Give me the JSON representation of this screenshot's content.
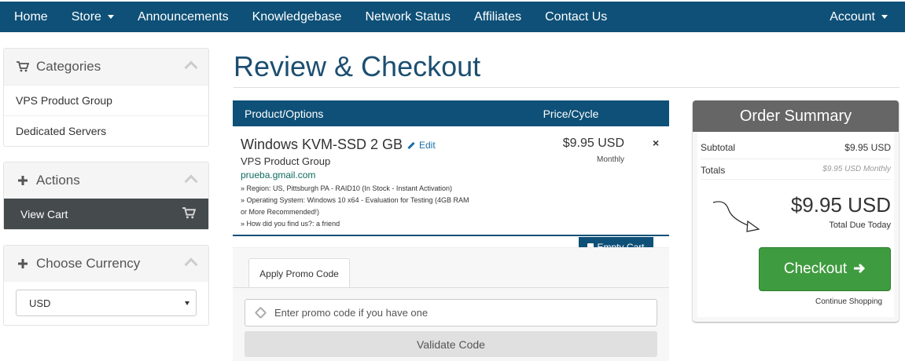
{
  "nav": {
    "home": "Home",
    "store": "Store",
    "announcements": "Announcements",
    "knowledgebase": "Knowledgebase",
    "network_status": "Network Status",
    "affiliates": "Affiliates",
    "contact_us": "Contact Us",
    "account": "Account"
  },
  "sidebar": {
    "categories": {
      "title": "Categories",
      "items": [
        "VPS Product Group",
        "Dedicated Servers"
      ]
    },
    "actions": {
      "title": "Actions",
      "items": [
        "View Cart"
      ]
    },
    "currency": {
      "title": "Choose Currency",
      "selected": "USD"
    }
  },
  "main": {
    "title": "Review & Checkout",
    "table_headers": {
      "product": "Product/Options",
      "price": "Price/Cycle"
    },
    "item": {
      "name": "Windows KVM-SSD 2 GB",
      "edit": "Edit",
      "group": "VPS Product Group",
      "domain": "prueba.gmail.com",
      "options": [
        "» Region: US, Pittsburgh PA - RAID10 (In Stock - Instant Activation)",
        "» Operating System: Windows 10 x64 - Evaluation for Testing (4GB RAM or More Recommended!)",
        "» How did you find us?: a friend"
      ],
      "price": "$9.95 USD",
      "cycle": "Monthly",
      "remove": "×"
    },
    "empty_cart": "Empty Cart",
    "promo": {
      "tab": "Apply Promo Code",
      "placeholder": "Enter promo code if you have one",
      "validate": "Validate Code"
    }
  },
  "summary": {
    "title": "Order Summary",
    "subtotal_label": "Subtotal",
    "subtotal_value": "$9.95 USD",
    "totals_label": "Totals",
    "totals_value": "$9.95 USD Monthly",
    "total_due": "$9.95 USD",
    "total_due_label": "Total Due Today",
    "checkout": "Checkout",
    "continue": "Continue Shopping"
  },
  "colors": {
    "brand": "#0e5077",
    "checkout": "#3f9b3f",
    "summary_head": "#666666"
  }
}
